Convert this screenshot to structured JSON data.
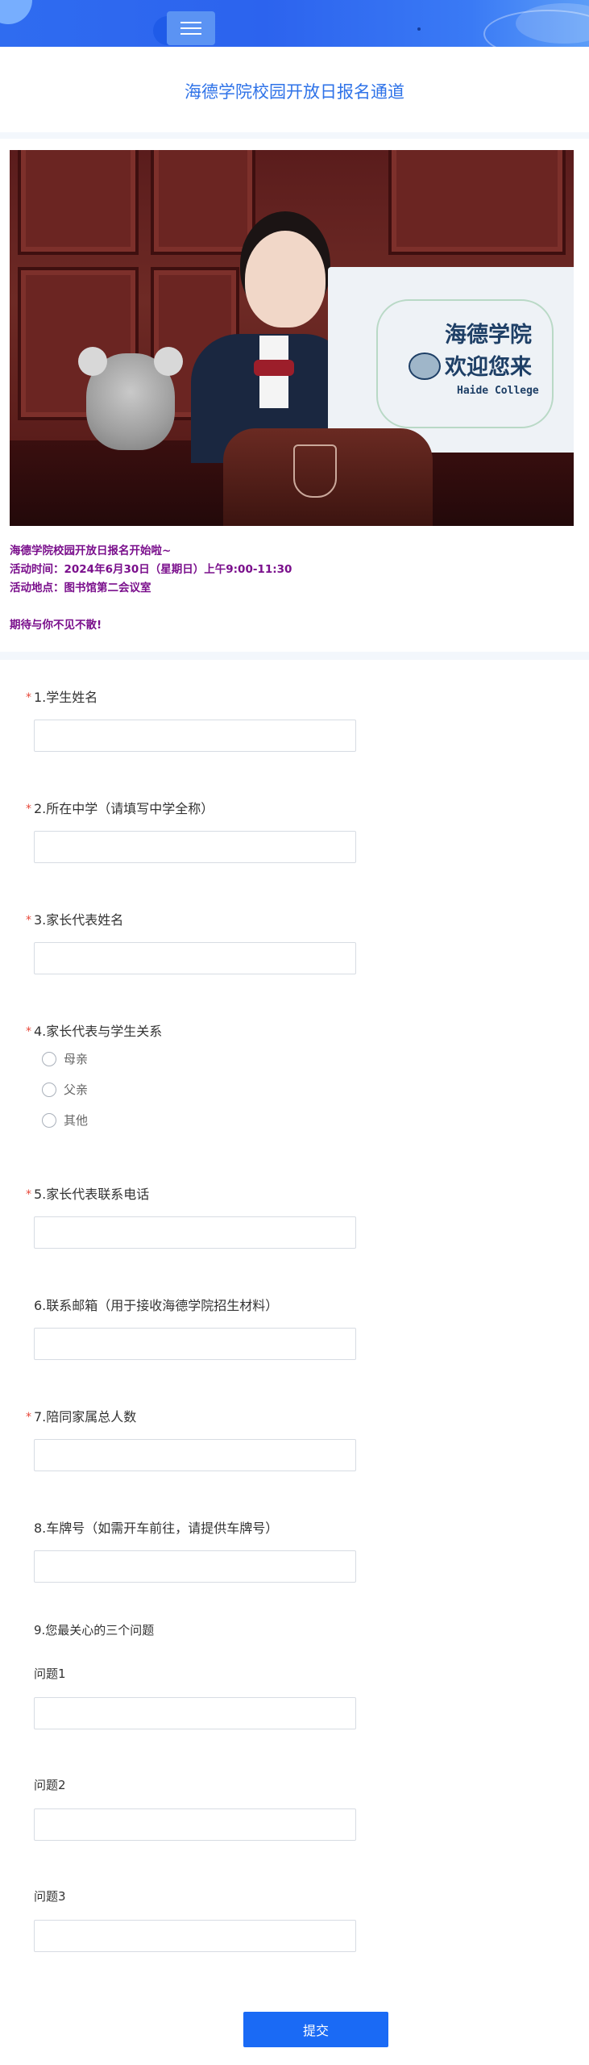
{
  "header": {
    "title": "海德学院校园开放日报名通道"
  },
  "intro": {
    "photo_sign_line1": "海德学院",
    "photo_sign_line2": "欢迎您来",
    "photo_sign_line3": "Haide College",
    "lines": [
      "海德学院校园开放日报名开始啦~",
      "活动时间：2024年6月30日（星期日）上午9:00-11:30",
      "活动地点：图书馆第二会议室",
      "期待与你不见不散!"
    ]
  },
  "form": {
    "required_mark": "*",
    "q1": {
      "label": "1.学生姓名"
    },
    "q2": {
      "label": "2.所在中学（请填写中学全称）"
    },
    "q3": {
      "label": "3.家长代表姓名"
    },
    "q4": {
      "label": "4.家长代表与学生关系",
      "options": [
        "母亲",
        "父亲",
        "其他"
      ]
    },
    "q5": {
      "label": "5.家长代表联系电话"
    },
    "q6": {
      "label": "6.联系邮箱（用于接收海德学院招生材料）"
    },
    "q7": {
      "label": "7.陪同家属总人数"
    },
    "q8": {
      "label": "8.车牌号（如需开车前往，请提供车牌号）"
    },
    "q9": {
      "label": "9.您最关心的三个问题",
      "sub": [
        "问题1",
        "问题2",
        "问题3"
      ]
    },
    "submit_label": "提交"
  },
  "colors": {
    "accent": "#1a6af5",
    "title": "#2f73e8",
    "intro_text": "#7a0f8c",
    "required": "#e8483a"
  }
}
